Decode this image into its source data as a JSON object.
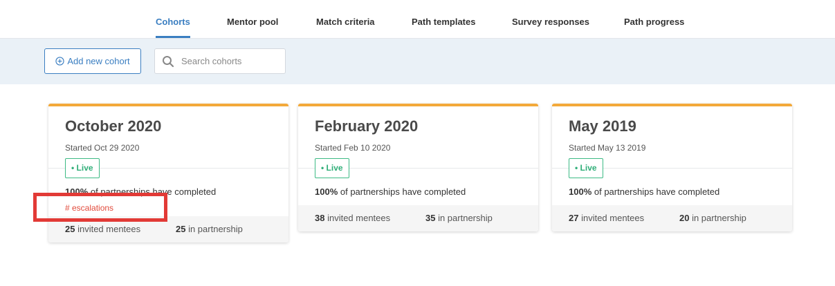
{
  "nav": {
    "tabs": [
      {
        "label": "Cohorts",
        "active": true
      },
      {
        "label": "Mentor pool",
        "active": false
      },
      {
        "label": "Match criteria",
        "active": false
      },
      {
        "label": "Path templates",
        "active": false
      },
      {
        "label": "Survey responses",
        "active": false
      },
      {
        "label": "Path progress",
        "active": false
      }
    ]
  },
  "toolbar": {
    "add_label": "Add new cohort",
    "search_placeholder": "Search cohorts"
  },
  "cohorts": [
    {
      "title": "October 2020",
      "started": "Started Oct 29 2020",
      "status": "• Live",
      "completed_pct": "100%",
      "completed_text": " of partnerships have completed",
      "escalations": "# escalations",
      "invited_count": "25",
      "invited_label": " invited mentees",
      "partner_count": "25",
      "partner_label": " in partnership"
    },
    {
      "title": "February 2020",
      "started": "Started Feb 10 2020",
      "status": "• Live",
      "completed_pct": "100%",
      "completed_text": " of partnerships have completed",
      "invited_count": "38",
      "invited_label": " invited mentees",
      "partner_count": "35",
      "partner_label": " in partnership"
    },
    {
      "title": "May 2019",
      "started": "Started May 13 2019",
      "status": "• Live",
      "completed_pct": "100%",
      "completed_text": " of partnerships have completed",
      "invited_count": "27",
      "invited_label": " invited mentees",
      "partner_count": "20",
      "partner_label": " in partnership"
    }
  ],
  "colors": {
    "accent": "#3a7ec1",
    "card_top": "#f3a93a",
    "live": "#2fae78",
    "escalation": "#e14a3b",
    "highlight": "#e23a36"
  }
}
